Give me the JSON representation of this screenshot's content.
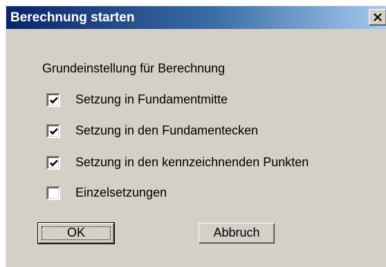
{
  "dialog": {
    "title": "Berechnung starten",
    "close_icon": "close-icon",
    "group_label": "Grundeinstellung für Berechnung",
    "options": [
      {
        "label": "Setzung in Fundamentmitte",
        "checked": true
      },
      {
        "label": "Setzung in den Fundamentecken",
        "checked": true
      },
      {
        "label": "Setzung in den kennzeichnenden Punkten",
        "checked": true
      },
      {
        "label": "Einzelsetzungen",
        "checked": false
      }
    ],
    "ok_label": "OK",
    "cancel_label": "Abbruch"
  },
  "colors": {
    "title_gradient_start": "#0a246a",
    "title_gradient_end": "#a6caf0",
    "face": "#d4d0c8"
  }
}
